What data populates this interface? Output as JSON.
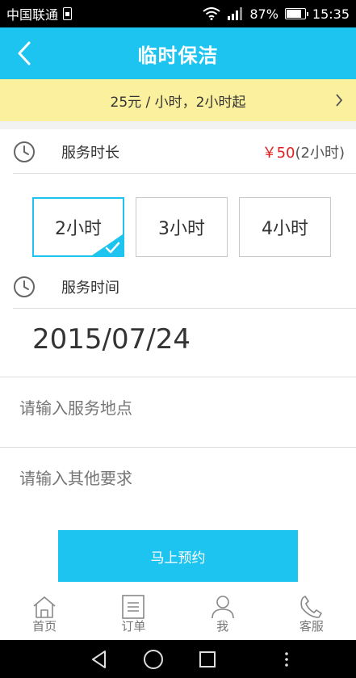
{
  "status_bar": {
    "carrier": "中国联通",
    "battery_percent": "87%",
    "battery_level": 0.87,
    "time": "15:35",
    "icons": [
      "sim-card-icon",
      "wifi-icon",
      "signal-icon",
      "battery-icon"
    ]
  },
  "nav": {
    "title": "临时保洁",
    "back_icon": "chevron-left-icon"
  },
  "promo": {
    "text": "25元 / 小时，2小时起",
    "arrow_icon": "chevron-right-icon"
  },
  "duration": {
    "label": "服务时长",
    "price_currency": "￥50",
    "price_unit": "(2小时)",
    "options": [
      "2小时",
      "3小时",
      "4小时"
    ],
    "selected_index": 0
  },
  "service_time": {
    "label": "服务时间",
    "date": "2015/07/24"
  },
  "address_field": {
    "placeholder": "请输入服务地点"
  },
  "requirements_field": {
    "placeholder": "请输入其他要求"
  },
  "book_button": {
    "label": "马上预约"
  },
  "tabs": [
    {
      "label": "首页",
      "icon": "home-icon"
    },
    {
      "label": "订单",
      "icon": "order-list-icon"
    },
    {
      "label": "我",
      "icon": "user-icon"
    },
    {
      "label": "客服",
      "icon": "phone-icon"
    }
  ],
  "colors": {
    "accent": "#1dc4ef",
    "promo_bg": "#fbf09d",
    "price_red": "#e02020"
  }
}
